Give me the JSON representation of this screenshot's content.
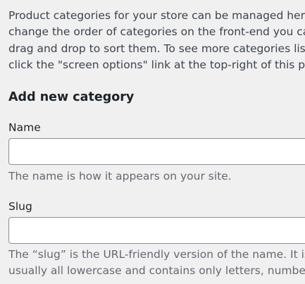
{
  "intro": {
    "lines": [
      "Product categories for your store can be managed here. To",
      "change the order of categories on the front-end you can",
      "drag and drop to sort them. To see more categories listed",
      "click the \"screen options\" link at the top-right of this page."
    ]
  },
  "form": {
    "title": "Add new category",
    "name": {
      "label": "Name",
      "value": "",
      "help": "The name is how it appears on your site."
    },
    "slug": {
      "label": "Slug",
      "value": "",
      "help_lines": [
        "The “slug” is the URL-friendly version of the name. It is",
        "usually all lowercase and contains only letters, numbers,"
      ]
    }
  },
  "colors": {
    "background": "#f0f0f1",
    "text": "#3c434a",
    "heading": "#1d2327",
    "help_text": "#646970",
    "input_border": "#8c8f94"
  }
}
